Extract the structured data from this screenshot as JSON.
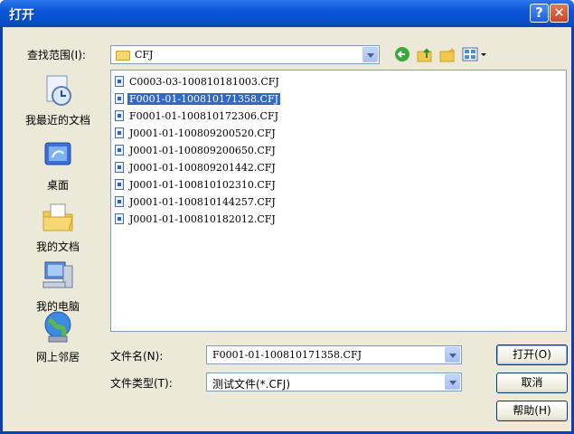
{
  "window": {
    "title": "打开",
    "help_button": "?",
    "close_button": "✕"
  },
  "look_in": {
    "label": "查找范围(I):",
    "value": "CFJ"
  },
  "toolbar": {
    "icons": [
      "back-icon",
      "up-folder-icon",
      "new-folder-icon",
      "views-menu-icon"
    ]
  },
  "places": [
    {
      "label": "我最近的文档",
      "icon": "recent-documents-icon"
    },
    {
      "label": "桌面",
      "icon": "desktop-icon"
    },
    {
      "label": "我的文档",
      "icon": "my-documents-icon"
    },
    {
      "label": "我的电脑",
      "icon": "my-computer-icon"
    },
    {
      "label": "网上邻居",
      "icon": "network-places-icon"
    }
  ],
  "files": [
    {
      "name": "C0003-03-100810181003.CFJ",
      "selected": false
    },
    {
      "name": "F0001-01-100810171358.CFJ",
      "selected": true
    },
    {
      "name": "F0001-01-100810172306.CFJ",
      "selected": false
    },
    {
      "name": "J0001-01-100809200520.CFJ",
      "selected": false
    },
    {
      "name": "J0001-01-100809200650.CFJ",
      "selected": false
    },
    {
      "name": "J0001-01-100809201442.CFJ",
      "selected": false
    },
    {
      "name": "J0001-01-100810102310.CFJ",
      "selected": false
    },
    {
      "name": "J0001-01-100810144257.CFJ",
      "selected": false
    },
    {
      "name": "J0001-01-100810182012.CFJ",
      "selected": false
    }
  ],
  "file_name": {
    "label": "文件名(N):",
    "value": "F0001-01-100810171358.CFJ"
  },
  "file_type": {
    "label": "文件类型(T):",
    "value": "测试文件(*.CFJ)"
  },
  "buttons": {
    "open": "打开(O)",
    "cancel": "取消",
    "help": "帮助(H)"
  }
}
